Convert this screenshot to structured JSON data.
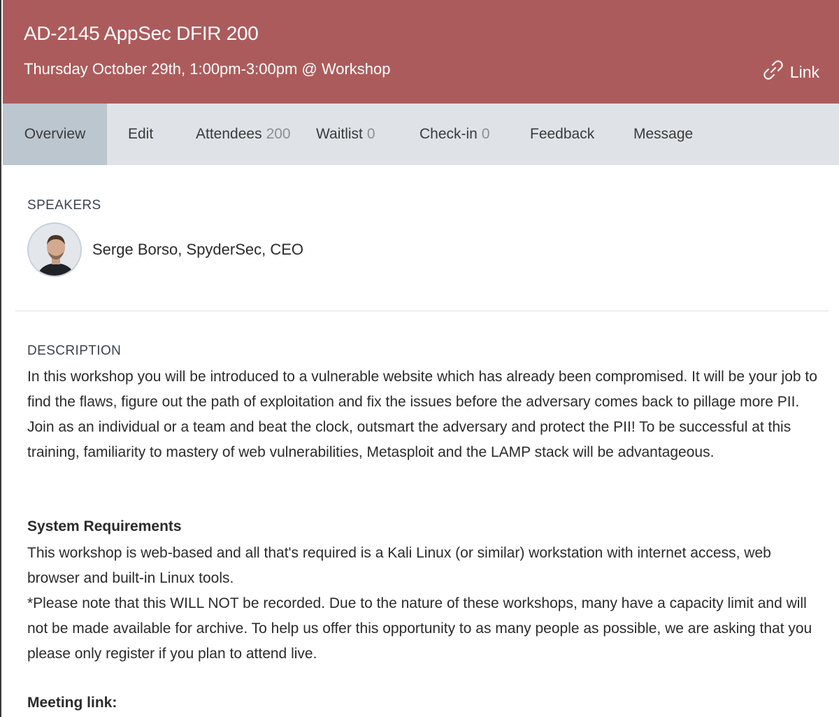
{
  "header": {
    "title": "AD-2145 AppSec DFIR 200",
    "subtitle": "Thursday October 29th, 1:00pm-3:00pm @ Workshop",
    "link_label": "Link",
    "link_icon": "link-icon",
    "background_color": "#ac5b5c"
  },
  "tabs": [
    {
      "label": "Overview",
      "count": null,
      "active": true
    },
    {
      "label": "Edit",
      "count": null,
      "active": false
    },
    {
      "label": "Attendees",
      "count": "200",
      "active": false
    },
    {
      "label": "Waitlist",
      "count": "0",
      "active": false
    },
    {
      "label": "Check-in",
      "count": "0",
      "active": false
    },
    {
      "label": "Feedback",
      "count": null,
      "active": false
    },
    {
      "label": "Message",
      "count": null,
      "active": false
    }
  ],
  "speakers": {
    "heading": "SPEAKERS",
    "items": [
      {
        "name": "Serge Borso, SpyderSec, CEO"
      }
    ]
  },
  "description": {
    "heading": "DESCRIPTION",
    "body": "In this workshop you will be introduced to a vulnerable website which has already been compromised. It will be your job to find the flaws, figure out the path of exploitation and fix the issues before the adversary comes back to pillage more PII. Join as an individual or a team and beat the clock, outsmart the adversary and protect the PII! To be successful at this training, familiarity to mastery of web vulnerabilities, Metasploit and the LAMP stack will be advantageous.",
    "system_requirements_heading": "System Requirements",
    "system_requirements_body": "This workshop is web-based and all that's required is a Kali Linux (or similar) workstation with internet access, web browser and built-in Linux tools.",
    "note": "*Please note that this WILL NOT be recorded. Due to the nature of these workshops, many have a capacity limit and will not be made available for archive. To help us offer this opportunity to as many people as possible, we are asking that you please only register if you plan to attend live.",
    "meeting_link_heading": "Meeting link:"
  }
}
